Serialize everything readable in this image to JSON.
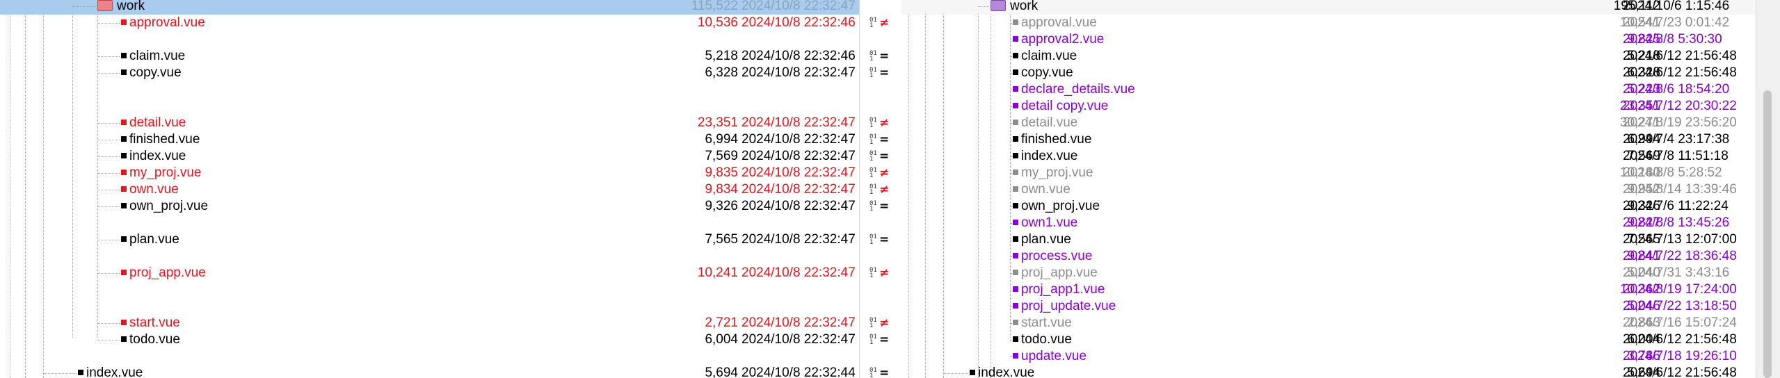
{
  "left": {
    "rows": [
      {
        "type": "folder",
        "name": "work",
        "size": "115,522",
        "date": "2024/10/8 22:32:47",
        "state": "sel"
      },
      {
        "type": "file",
        "name": "approval.vue",
        "size": "10,536",
        "date": "2024/10/8 22:32:46",
        "state": "diff"
      },
      {
        "type": "empty"
      },
      {
        "type": "file",
        "name": "claim.vue",
        "size": "5,218",
        "date": "2024/10/8 22:32:46",
        "state": "same"
      },
      {
        "type": "file",
        "name": "copy.vue",
        "size": "6,328",
        "date": "2024/10/8 22:32:47",
        "state": "same"
      },
      {
        "type": "empty"
      },
      {
        "type": "empty"
      },
      {
        "type": "file",
        "name": "detail.vue",
        "size": "23,351",
        "date": "2024/10/8 22:32:47",
        "state": "diff"
      },
      {
        "type": "file",
        "name": "finished.vue",
        "size": "6,994",
        "date": "2024/10/8 22:32:47",
        "state": "same"
      },
      {
        "type": "file",
        "name": "index.vue",
        "size": "7,569",
        "date": "2024/10/8 22:32:47",
        "state": "same"
      },
      {
        "type": "file",
        "name": "my_proj.vue",
        "size": "9,835",
        "date": "2024/10/8 22:32:47",
        "state": "diff"
      },
      {
        "type": "file",
        "name": "own.vue",
        "size": "9,834",
        "date": "2024/10/8 22:32:47",
        "state": "diff"
      },
      {
        "type": "file",
        "name": "own_proj.vue",
        "size": "9,326",
        "date": "2024/10/8 22:32:47",
        "state": "same"
      },
      {
        "type": "empty"
      },
      {
        "type": "file",
        "name": "plan.vue",
        "size": "7,565",
        "date": "2024/10/8 22:32:47",
        "state": "same"
      },
      {
        "type": "empty"
      },
      {
        "type": "file",
        "name": "proj_app.vue",
        "size": "10,241",
        "date": "2024/10/8 22:32:47",
        "state": "diff"
      },
      {
        "type": "empty"
      },
      {
        "type": "empty"
      },
      {
        "type": "file",
        "name": "start.vue",
        "size": "2,721",
        "date": "2024/10/8 22:32:47",
        "state": "diff"
      },
      {
        "type": "file",
        "name": "todo.vue",
        "size": "6,004",
        "date": "2024/10/8 22:32:47",
        "state": "same"
      },
      {
        "type": "empty"
      },
      {
        "type": "file",
        "name": "index.vue",
        "size": "5,694",
        "date": "2024/10/8 22:32:44",
        "state": "same",
        "level": 1
      }
    ]
  },
  "middle": {
    "marks": [
      "",
      "ne",
      "",
      "eq",
      "eq",
      "",
      "",
      "ne",
      "eq",
      "eq",
      "ne",
      "ne",
      "eq",
      "",
      "eq",
      "",
      "ne",
      "",
      "",
      "ne",
      "eq",
      "",
      "eq"
    ]
  },
  "right": {
    "rows": [
      {
        "type": "folder",
        "name": "work",
        "size": "195,112",
        "date": "2024/10/6 1:15:46",
        "state": "stripe"
      },
      {
        "type": "file",
        "name": "approval.vue",
        "size": "10,541",
        "date": "2024/7/23 0:01:42",
        "state": "older"
      },
      {
        "type": "file",
        "name": "approval2.vue",
        "size": "9,825",
        "date": "2024/8/8 5:30:30",
        "state": "orphan"
      },
      {
        "type": "file",
        "name": "claim.vue",
        "size": "5,218",
        "date": "2024/6/12 21:56:48",
        "state": "same"
      },
      {
        "type": "file",
        "name": "copy.vue",
        "size": "6,328",
        "date": "2024/6/12 21:56:48",
        "state": "same"
      },
      {
        "type": "file",
        "name": "declare_details.vue",
        "size": "5,223",
        "date": "2024/8/6 18:54:20",
        "state": "orphan"
      },
      {
        "type": "file",
        "name": "detail copy.vue",
        "size": "23,351",
        "date": "2024/7/12 20:30:22",
        "state": "orphan"
      },
      {
        "type": "file",
        "name": "detail.vue",
        "size": "30,271",
        "date": "2024/8/19 23:56:20",
        "state": "older"
      },
      {
        "type": "file",
        "name": "finished.vue",
        "size": "6,994",
        "date": "2024/7/4 23:17:38",
        "state": "same"
      },
      {
        "type": "file",
        "name": "index.vue",
        "size": "7,569",
        "date": "2024/7/8 11:51:18",
        "state": "same"
      },
      {
        "type": "file",
        "name": "my_proj.vue",
        "size": "10,180",
        "date": "2024/8/8 5:28:52",
        "state": "older"
      },
      {
        "type": "file",
        "name": "own.vue",
        "size": "9,952",
        "date": "2024/8/14 13:39:46",
        "state": "older"
      },
      {
        "type": "file",
        "name": "own_proj.vue",
        "size": "9,326",
        "date": "2024/7/6 11:22:24",
        "state": "same"
      },
      {
        "type": "file",
        "name": "own1.vue",
        "size": "9,827",
        "date": "2024/8/8 13:45:26",
        "state": "orphan"
      },
      {
        "type": "file",
        "name": "plan.vue",
        "size": "7,565",
        "date": "2024/7/13 12:07:00",
        "state": "same"
      },
      {
        "type": "file",
        "name": "process.vue",
        "size": "9,841",
        "date": "2024/7/22 18:36:48",
        "state": "orphan"
      },
      {
        "type": "file",
        "name": "proj_app.vue",
        "size": "5,040",
        "date": "2024/7/31 3:43:16",
        "state": "older"
      },
      {
        "type": "file",
        "name": "proj_app1.vue",
        "size": "10,362",
        "date": "2024/8/19 17:24:00",
        "state": "orphan"
      },
      {
        "type": "file",
        "name": "proj_update.vue",
        "size": "5,046",
        "date": "2024/7/22 13:18:50",
        "state": "orphan"
      },
      {
        "type": "file",
        "name": "start.vue",
        "size": "2,863",
        "date": "2024/7/16 15:07:24",
        "state": "older"
      },
      {
        "type": "file",
        "name": "todo.vue",
        "size": "6,004",
        "date": "2024/6/12 21:56:48",
        "state": "same"
      },
      {
        "type": "file",
        "name": "update.vue",
        "size": "3,786",
        "date": "2024/7/18 19:26:10",
        "state": "orphan"
      },
      {
        "type": "file",
        "name": "index.vue",
        "size": "5,694",
        "date": "2024/6/12 21:56:48",
        "state": "same",
        "level": 1
      }
    ]
  },
  "colors": {
    "different": "#e8141c",
    "orphan": "#8a00d4",
    "older": "#8c8c8c",
    "selection": "#a8cbee"
  },
  "icons": {
    "folder": "folder-icon",
    "not_equal": "not-equal-icon",
    "equal": "equal-icon"
  }
}
